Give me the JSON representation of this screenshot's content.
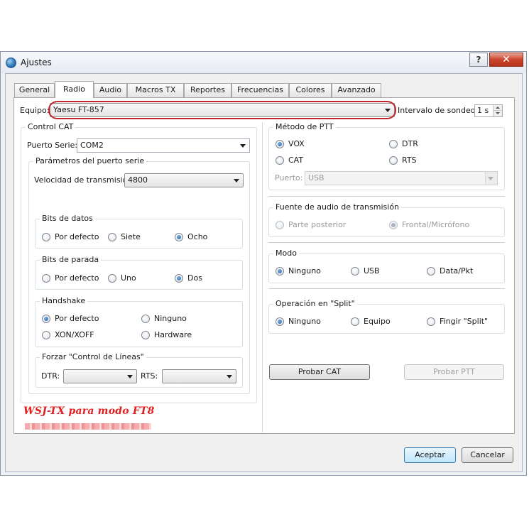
{
  "window": {
    "title": "Ajustes",
    "help_label": "?",
    "close_label": "✕"
  },
  "tabs": [
    "General",
    "Radio",
    "Audio",
    "Macros TX",
    "Reportes",
    "Frecuencias",
    "Colores",
    "Avanzado"
  ],
  "active_tab": "Radio",
  "rig": {
    "label": "Equipo:",
    "value": "Yaesu FT-857",
    "poll_label": "Intervalo de sondeo:",
    "poll_value": "1 s"
  },
  "cat": {
    "title": "Control CAT",
    "port_label": "Puerto Serie:",
    "port_value": "COM2",
    "serial_title": "Parámetros del puerto serie",
    "baud_label": "Velocidad de transmisión:",
    "baud_value": "4800",
    "data_bits": {
      "title": "Bits de datos",
      "options": [
        "Por defecto",
        "Siete",
        "Ocho"
      ],
      "selected": "Ocho"
    },
    "stop_bits": {
      "title": "Bits de parada",
      "options": [
        "Por defecto",
        "Uno",
        "Dos"
      ],
      "selected": "Dos"
    },
    "handshake": {
      "title": "Handshake",
      "options": [
        "Por defecto",
        "Ninguno",
        "XON/XOFF",
        "Hardware"
      ],
      "selected": "Por defecto"
    },
    "force_lines": {
      "title": "Forzar \"Control de Líneas\"",
      "dtr_label": "DTR:",
      "rts_label": "RTS:"
    }
  },
  "ptt": {
    "title": "Método de PTT",
    "options": [
      "VOX",
      "DTR",
      "CAT",
      "RTS"
    ],
    "selected": "VOX",
    "port_label": "Puerto:",
    "port_value": "USB"
  },
  "audio_source": {
    "title": "Fuente de audio de transmisión",
    "options": [
      "Parte posterior",
      "Frontal/Micrófono"
    ],
    "selected": "Frontal/Micrófono"
  },
  "mode": {
    "title": "Modo",
    "options": [
      "Ninguno",
      "USB",
      "Data/Pkt"
    ],
    "selected": "Ninguno"
  },
  "split": {
    "title": "Operación en \"Split\"",
    "options": [
      "Ninguno",
      "Equipo",
      "Fingir \"Split\""
    ],
    "selected": "Ninguno"
  },
  "buttons": {
    "test_cat": "Probar CAT",
    "test_ptt": "Probar PTT",
    "ok": "Aceptar",
    "cancel": "Cancelar"
  },
  "watermark": "WSJ-TX para modo FT8",
  "colors": {
    "highlight": "#c0262c",
    "watermark": "#e02020",
    "radio_checked": "#1c5aa0"
  }
}
